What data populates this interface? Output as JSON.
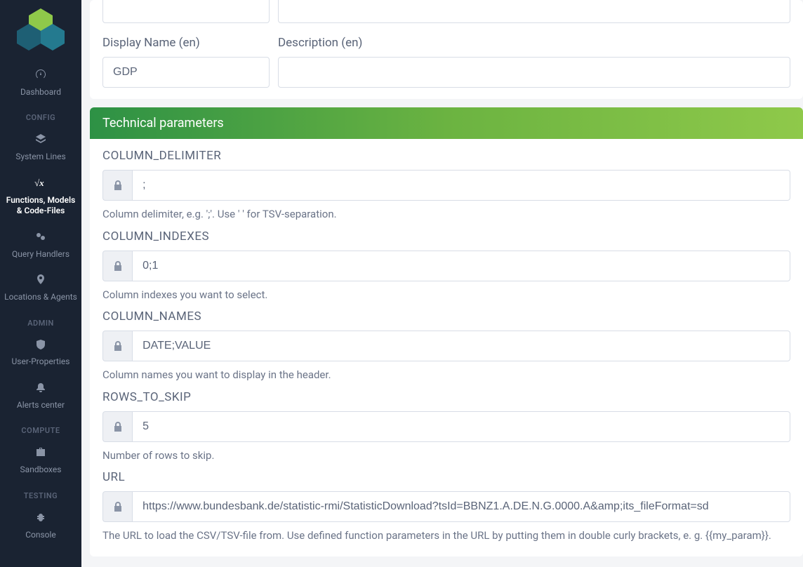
{
  "sidebar": {
    "items": [
      {
        "icon": "dashboard",
        "label": "Dashboard",
        "active": false
      },
      {
        "section": "CONFIG"
      },
      {
        "icon": "layers",
        "label": "System Lines",
        "active": false
      },
      {
        "icon": "fx",
        "label": "Functions, Models & Code-Files",
        "active": true
      },
      {
        "icon": "cogs",
        "label": "Query Handlers",
        "active": false
      },
      {
        "icon": "pin",
        "label": "Locations & Agents",
        "active": false
      },
      {
        "section": "ADMIN"
      },
      {
        "icon": "shield",
        "label": "User-Properties",
        "active": false
      },
      {
        "icon": "bell",
        "label": "Alerts center",
        "active": false
      },
      {
        "section": "COMPUTE"
      },
      {
        "icon": "briefcase",
        "label": "Sandboxes",
        "active": false
      },
      {
        "section": "TESTING"
      },
      {
        "icon": "bug",
        "label": "Console",
        "active": false
      }
    ]
  },
  "topForm": {
    "leftTop": {
      "value": ""
    },
    "rightTop": {
      "value": ""
    },
    "displayNameLabel": "Display Name (en)",
    "displayNameValue": "GDP",
    "descriptionLabel": "Description (en)",
    "descriptionValue": ""
  },
  "technical": {
    "header": "Technical parameters",
    "params": [
      {
        "name": "COLUMN_DELIMITER",
        "value": ";",
        "help": "Column delimiter, e.g. ';'. Use ' ' for TSV-separation."
      },
      {
        "name": "COLUMN_INDEXES",
        "value": "0;1",
        "help": "Column indexes you want to select."
      },
      {
        "name": "COLUMN_NAMES",
        "value": "DATE;VALUE",
        "help": "Column names you want to display in the header."
      },
      {
        "name": "ROWS_TO_SKIP",
        "value": "5",
        "help": "Number of rows to skip."
      },
      {
        "name": "URL",
        "value": "https://www.bundesbank.de/statistic-rmi/StatisticDownload?tsId=BBNZ1.A.DE.N.G.0000.A&amp;its_fileFormat=sd",
        "help": "The URL to load the CSV/TSV-file from. Use defined function parameters in the URL by putting them in double curly brackets, e. g. {{my_param}}."
      }
    ]
  }
}
